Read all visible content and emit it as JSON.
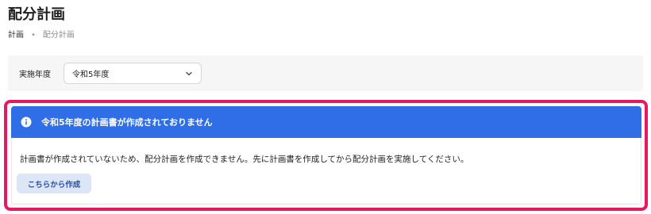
{
  "page": {
    "title": "配分計画"
  },
  "breadcrumb": {
    "root": "計画",
    "separator": "•",
    "current": "配分計画"
  },
  "filter": {
    "label": "実施年度",
    "selected_value": "令和5年度"
  },
  "alert": {
    "icon": "info-icon",
    "title": "令和5年度の計画書が作成されておりません",
    "message": "計画書が作成されていないため、配分計画を作成できません。先に計画書を作成してから配分計画を実施してください。",
    "action_label": "こちらから作成"
  },
  "colors": {
    "alert_header": "#2f6ee6",
    "highlight_border": "#e8185e",
    "button_bg": "#dde6f7",
    "button_text": "#2a4fa8"
  }
}
